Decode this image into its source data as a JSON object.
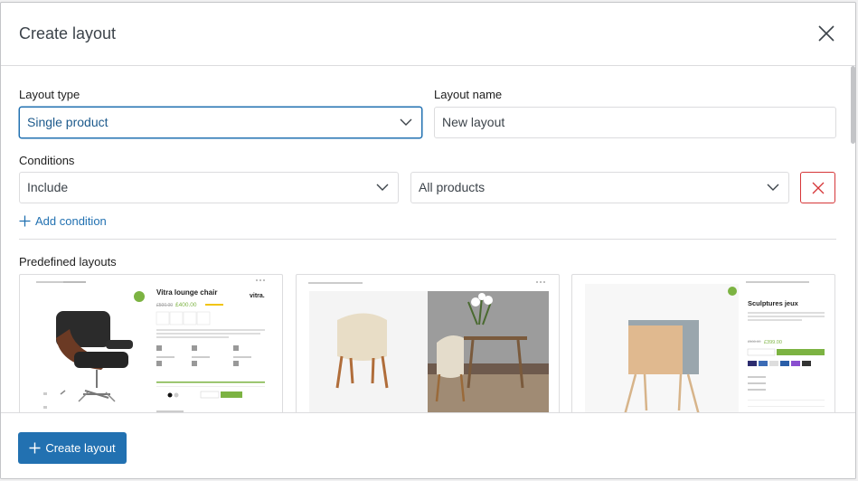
{
  "dialog": {
    "title": "Create layout"
  },
  "form": {
    "layout_type_label": "Layout type",
    "layout_type_value": "Single product",
    "layout_name_label": "Layout name",
    "layout_name_value": "New layout",
    "conditions_label": "Conditions",
    "condition_mode_value": "Include",
    "condition_target_value": "All products",
    "add_condition_label": "Add condition"
  },
  "predefined": {
    "label": "Predefined layouts",
    "cards": [
      {
        "product_title": "Vitra lounge chair",
        "price_old": "£500.00",
        "price_new": "£400.00",
        "brand": "vitra."
      },
      {
        "product_title": ""
      },
      {
        "product_title": "Sculptures jeux",
        "price_old": "£500.00",
        "price_new": "£399.00",
        "badge": "-20%"
      }
    ]
  },
  "footer": {
    "create_label": "Create layout"
  },
  "colors": {
    "accent": "#2271b1",
    "danger": "#d63638",
    "sale_badge": "#7cb342"
  }
}
